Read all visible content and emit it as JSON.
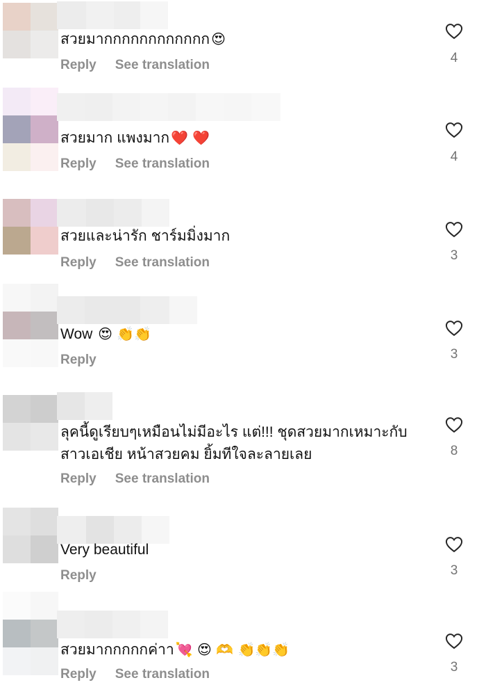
{
  "comments": [
    {
      "text": "สวยมากกกกกกกกกกกก",
      "emojis": "😍",
      "reply": "Reply",
      "translate": "See translation",
      "likes": "4",
      "avatar": [
        "#e8d2c8",
        "#e6e1dc",
        "#e4e1df",
        "#ecebea"
      ],
      "name": [
        "#ececec",
        "#f1f1f1",
        "#eeeeee",
        "#f6f6f6"
      ]
    },
    {
      "text": "สวยมาก แพงมาก",
      "emojis": "❤️ ❤️",
      "reply": "Reply",
      "translate": "See translation",
      "likes": "4",
      "avatar": [
        "#f3eaf6",
        "#faeef8",
        "#a3a3b8",
        "#cfb0c8",
        "#f2ede2",
        "#fbf0f0"
      ],
      "name": [
        "#f0f0f0",
        "#efefef",
        "#f3f3f3",
        "#f5f5f5",
        "#f3f3f3",
        "#f7f7f7",
        "#f6f6f6",
        "#f8f8f8"
      ]
    },
    {
      "text": "สวยและน่ารัก ชาร์มมิ่งมาก",
      "emojis": "",
      "reply": "Reply",
      "translate": "See translation",
      "likes": "3",
      "avatar": [
        "#d8bebf",
        "#e9d4e4",
        "#bba88f",
        "#efcdcc"
      ],
      "name": [
        "#ececec",
        "#e8e8e8",
        "#ececec",
        "#f4f4f4"
      ]
    },
    {
      "text": "Wow",
      "emojis": "😍 👏👏",
      "reply": "Reply",
      "translate": "",
      "likes": "3",
      "avatar": [
        "#f7f7f7",
        "#f3f3f3",
        "#c7b6b9",
        "#c2bebf",
        "#f9f9f9",
        "#f8f8f8"
      ],
      "name": [
        "#ececec",
        "#e9e9e9",
        "#e9e9e9",
        "#eeeeee",
        "#f6f6f6"
      ]
    },
    {
      "text": "ลุคนี้ดูเรียบๆเหมือนไม่มีอะไร แต่!!! ชุดสวยมากเหมาะกับ",
      "text2": "สาวเอเชีย หน้าสวยคม ยิ้มทีใจละลายเลย",
      "emojis": "",
      "reply": "Reply",
      "translate": "See translation",
      "likes": "8",
      "avatar": [
        "#d3d3d3",
        "#cdcdcd",
        "#e4e4e4",
        "#e8e8e8"
      ],
      "name": [
        "#e6e6e6",
        "#eeeeee"
      ]
    },
    {
      "text": "Very beautiful",
      "emojis": "",
      "reply": "Reply",
      "translate": "",
      "likes": "3",
      "avatar": [
        "#e4e4e4",
        "#dedede",
        "#dedede",
        "#cfcfcf"
      ],
      "name": [
        "#eeeeee",
        "#e3e3e3",
        "#ececec",
        "#f6f6f6"
      ]
    },
    {
      "text": "สวยมากกกกกค่าา",
      "emojis": "💘 😍 🫶 👏👏👏",
      "reply": "Reply",
      "translate": "See translation",
      "likes": "3",
      "avatar": [
        "#fbfbfb",
        "#f7f7f7",
        "#b8bec1",
        "#c4c7c8",
        "#f2f3f5",
        "#f0f1f2"
      ],
      "name": [
        "#eeeeee",
        "#ececec",
        "#f0f0f0",
        "#f4f4f4"
      ]
    }
  ]
}
